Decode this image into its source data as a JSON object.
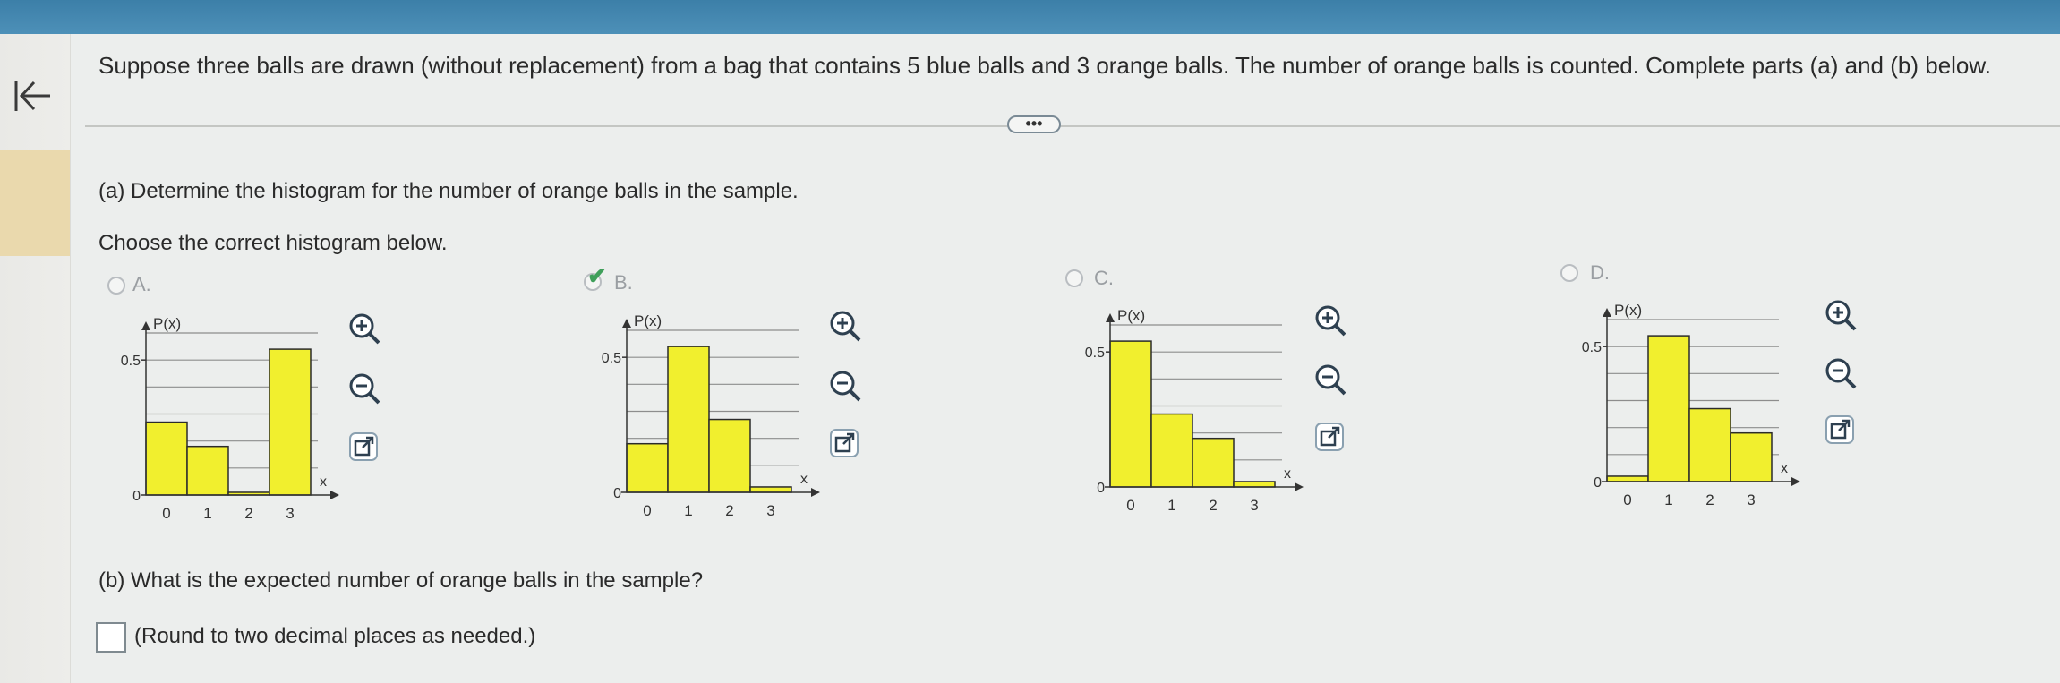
{
  "question": "Suppose three balls are drawn (without replacement) from a bag that contains 5 blue balls and 3 orange balls. The number of orange balls is counted. Complete parts (a) and (b) below.",
  "more_label": "•••",
  "part_a": {
    "prompt": "(a) Determine the histogram for the number of orange balls in the sample.",
    "instruction": "Choose the correct histogram below."
  },
  "part_b": {
    "prompt": "(b) What is the expected number of orange balls in the sample?",
    "hint": "(Round to two decimal places as needed.)",
    "answer_value": ""
  },
  "colors": {
    "bar_fill": "#f1ef2e",
    "bar_stroke": "#2b2b2b",
    "grid": "#8d8d8d",
    "check": "#3f9f5a",
    "header": "#4589b3"
  },
  "icons": {
    "back": "back-to-start-icon",
    "zoom_in": "zoom-in-icon",
    "zoom_out": "zoom-out-icon",
    "open_new": "open-new-window-icon"
  },
  "options": [
    {
      "label": "A.",
      "selected": false
    },
    {
      "label": "B.",
      "selected": true
    },
    {
      "label": "C.",
      "selected": false
    },
    {
      "label": "D.",
      "selected": false
    }
  ],
  "chart_data": [
    {
      "type": "bar",
      "title": "",
      "ylabel": "P(x)",
      "xlabel": "x",
      "categories": [
        "0",
        "1",
        "2",
        "3"
      ],
      "values": [
        0.27,
        0.18,
        0.01,
        0.54
      ],
      "ylim": [
        0,
        0.6
      ],
      "yticks": [
        "0",
        "0.5"
      ],
      "grid": true
    },
    {
      "type": "bar",
      "title": "",
      "ylabel": "P(x)",
      "xlabel": "x",
      "categories": [
        "0",
        "1",
        "2",
        "3"
      ],
      "values": [
        0.18,
        0.54,
        0.27,
        0.02
      ],
      "ylim": [
        0,
        0.6
      ],
      "yticks": [
        "0",
        "0.5"
      ],
      "grid": true
    },
    {
      "type": "bar",
      "title": "",
      "ylabel": "P(x)",
      "xlabel": "x",
      "categories": [
        "0",
        "1",
        "2",
        "3"
      ],
      "values": [
        0.54,
        0.27,
        0.18,
        0.02
      ],
      "ylim": [
        0,
        0.6
      ],
      "yticks": [
        "0",
        "0.5"
      ],
      "grid": true
    },
    {
      "type": "bar",
      "title": "",
      "ylabel": "P(x)",
      "xlabel": "x",
      "categories": [
        "0",
        "1",
        "2",
        "3"
      ],
      "values": [
        0.02,
        0.54,
        0.27,
        0.18
      ],
      "ylim": [
        0,
        0.6
      ],
      "yticks": [
        "0",
        "0.5"
      ],
      "grid": true
    }
  ]
}
